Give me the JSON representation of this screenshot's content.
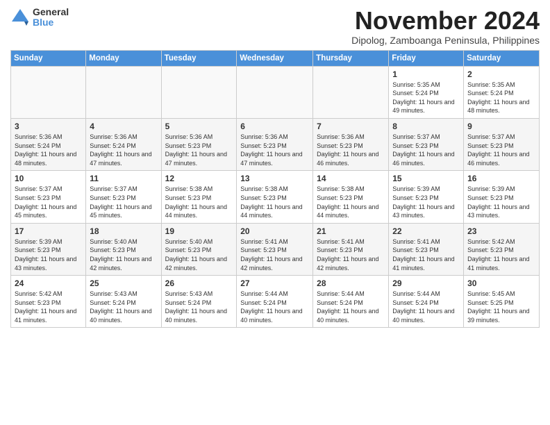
{
  "logo": {
    "general": "General",
    "blue": "Blue"
  },
  "title": "November 2024",
  "subtitle": "Dipolog, Zamboanga Peninsula, Philippines",
  "days_header": [
    "Sunday",
    "Monday",
    "Tuesday",
    "Wednesday",
    "Thursday",
    "Friday",
    "Saturday"
  ],
  "weeks": [
    [
      {
        "day": "",
        "info": "",
        "empty": true
      },
      {
        "day": "",
        "info": "",
        "empty": true
      },
      {
        "day": "",
        "info": "",
        "empty": true
      },
      {
        "day": "",
        "info": "",
        "empty": true
      },
      {
        "day": "",
        "info": "",
        "empty": true
      },
      {
        "day": "1",
        "info": "Sunrise: 5:35 AM\nSunset: 5:24 PM\nDaylight: 11 hours and 49 minutes."
      },
      {
        "day": "2",
        "info": "Sunrise: 5:35 AM\nSunset: 5:24 PM\nDaylight: 11 hours and 48 minutes."
      }
    ],
    [
      {
        "day": "3",
        "info": "Sunrise: 5:36 AM\nSunset: 5:24 PM\nDaylight: 11 hours and 48 minutes."
      },
      {
        "day": "4",
        "info": "Sunrise: 5:36 AM\nSunset: 5:24 PM\nDaylight: 11 hours and 47 minutes."
      },
      {
        "day": "5",
        "info": "Sunrise: 5:36 AM\nSunset: 5:23 PM\nDaylight: 11 hours and 47 minutes."
      },
      {
        "day": "6",
        "info": "Sunrise: 5:36 AM\nSunset: 5:23 PM\nDaylight: 11 hours and 47 minutes."
      },
      {
        "day": "7",
        "info": "Sunrise: 5:36 AM\nSunset: 5:23 PM\nDaylight: 11 hours and 46 minutes."
      },
      {
        "day": "8",
        "info": "Sunrise: 5:37 AM\nSunset: 5:23 PM\nDaylight: 11 hours and 46 minutes."
      },
      {
        "day": "9",
        "info": "Sunrise: 5:37 AM\nSunset: 5:23 PM\nDaylight: 11 hours and 46 minutes."
      }
    ],
    [
      {
        "day": "10",
        "info": "Sunrise: 5:37 AM\nSunset: 5:23 PM\nDaylight: 11 hours and 45 minutes."
      },
      {
        "day": "11",
        "info": "Sunrise: 5:37 AM\nSunset: 5:23 PM\nDaylight: 11 hours and 45 minutes."
      },
      {
        "day": "12",
        "info": "Sunrise: 5:38 AM\nSunset: 5:23 PM\nDaylight: 11 hours and 44 minutes."
      },
      {
        "day": "13",
        "info": "Sunrise: 5:38 AM\nSunset: 5:23 PM\nDaylight: 11 hours and 44 minutes."
      },
      {
        "day": "14",
        "info": "Sunrise: 5:38 AM\nSunset: 5:23 PM\nDaylight: 11 hours and 44 minutes."
      },
      {
        "day": "15",
        "info": "Sunrise: 5:39 AM\nSunset: 5:23 PM\nDaylight: 11 hours and 43 minutes."
      },
      {
        "day": "16",
        "info": "Sunrise: 5:39 AM\nSunset: 5:23 PM\nDaylight: 11 hours and 43 minutes."
      }
    ],
    [
      {
        "day": "17",
        "info": "Sunrise: 5:39 AM\nSunset: 5:23 PM\nDaylight: 11 hours and 43 minutes."
      },
      {
        "day": "18",
        "info": "Sunrise: 5:40 AM\nSunset: 5:23 PM\nDaylight: 11 hours and 42 minutes."
      },
      {
        "day": "19",
        "info": "Sunrise: 5:40 AM\nSunset: 5:23 PM\nDaylight: 11 hours and 42 minutes."
      },
      {
        "day": "20",
        "info": "Sunrise: 5:41 AM\nSunset: 5:23 PM\nDaylight: 11 hours and 42 minutes."
      },
      {
        "day": "21",
        "info": "Sunrise: 5:41 AM\nSunset: 5:23 PM\nDaylight: 11 hours and 42 minutes."
      },
      {
        "day": "22",
        "info": "Sunrise: 5:41 AM\nSunset: 5:23 PM\nDaylight: 11 hours and 41 minutes."
      },
      {
        "day": "23",
        "info": "Sunrise: 5:42 AM\nSunset: 5:23 PM\nDaylight: 11 hours and 41 minutes."
      }
    ],
    [
      {
        "day": "24",
        "info": "Sunrise: 5:42 AM\nSunset: 5:23 PM\nDaylight: 11 hours and 41 minutes."
      },
      {
        "day": "25",
        "info": "Sunrise: 5:43 AM\nSunset: 5:24 PM\nDaylight: 11 hours and 40 minutes."
      },
      {
        "day": "26",
        "info": "Sunrise: 5:43 AM\nSunset: 5:24 PM\nDaylight: 11 hours and 40 minutes."
      },
      {
        "day": "27",
        "info": "Sunrise: 5:44 AM\nSunset: 5:24 PM\nDaylight: 11 hours and 40 minutes."
      },
      {
        "day": "28",
        "info": "Sunrise: 5:44 AM\nSunset: 5:24 PM\nDaylight: 11 hours and 40 minutes."
      },
      {
        "day": "29",
        "info": "Sunrise: 5:44 AM\nSunset: 5:24 PM\nDaylight: 11 hours and 40 minutes."
      },
      {
        "day": "30",
        "info": "Sunrise: 5:45 AM\nSunset: 5:25 PM\nDaylight: 11 hours and 39 minutes."
      }
    ]
  ]
}
